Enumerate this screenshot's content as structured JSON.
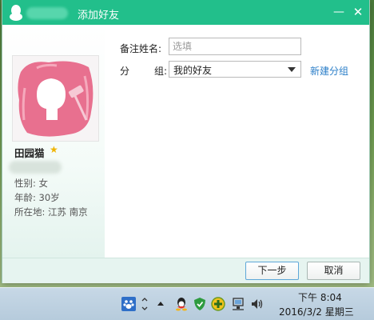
{
  "dialog": {
    "title": "添加好友",
    "minimize_glyph": "—",
    "close_glyph": "✕"
  },
  "profile": {
    "name": "田园猫",
    "gender": "性别: 女",
    "age": "年龄: 30岁",
    "location": "所在地: 江苏  南京",
    "star_glyph": "★"
  },
  "form": {
    "remark_label": "备注姓名:",
    "remark_placeholder": "选填",
    "group_label_1": "分",
    "group_label_2": "组:",
    "group_value": "我的好友",
    "new_group_link": "新建分组"
  },
  "buttons": {
    "next": "下一步",
    "cancel": "取消"
  },
  "taskbar": {
    "time": "下午 8:04",
    "date": "2016/3/2 星期三",
    "icons": [
      "baidu-paw-icon",
      "chevron-icon",
      "show-hidden-icon",
      "qq-icon",
      "security-shield-icon",
      "plus-icon",
      "network-icon",
      "volume-icon"
    ]
  },
  "colors": {
    "titlebar": "#22bf8b",
    "link": "#2a7ec8",
    "star": "#f0b400"
  }
}
